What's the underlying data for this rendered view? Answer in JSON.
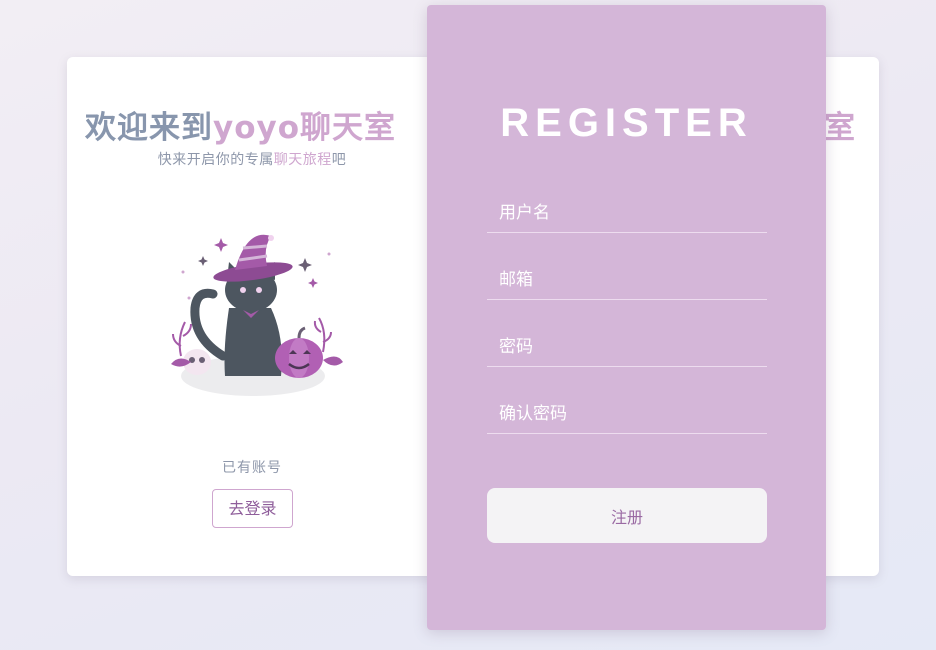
{
  "welcome": {
    "title_prefix": "欢迎来到",
    "title_suffix": "yoyo聊天室",
    "tagline_prefix": "快来开启你的专属",
    "tagline_accent": "聊天旅程",
    "tagline_suffix": "吧",
    "ghost_title_fragment": "室"
  },
  "illustration": {
    "icon": "witch-cat-with-pumpkin-and-skull"
  },
  "login": {
    "have_account": "已有账号",
    "goto_login_label": "去登录"
  },
  "register": {
    "title": "REGISTER",
    "username_placeholder": "用户名",
    "email_placeholder": "邮箱",
    "password_placeholder": "密码",
    "confirm_password_placeholder": "确认密码",
    "submit_label": "注册"
  },
  "colors": {
    "panel": "#d4b6d8",
    "accent_text": "#cfa6cf",
    "muted_text": "#8896ad",
    "button_text": "#9a6aa3"
  }
}
